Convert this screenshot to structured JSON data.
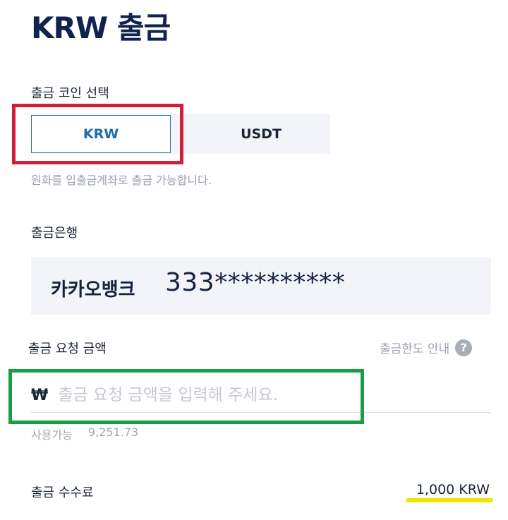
{
  "page": {
    "title": "KRW 출금"
  },
  "coin_select": {
    "label": "출금 코인 선택",
    "options": [
      "KRW",
      "USDT"
    ],
    "selected": "KRW",
    "hint": "원화를 입출금계좌로 출금 가능합니다."
  },
  "bank": {
    "label": "출금은행",
    "name": "카카오뱅크",
    "account_masked": "333**********"
  },
  "amount": {
    "label": "출금 요청 금액",
    "limit_guide": "출금한도 안내",
    "help_glyph": "?",
    "currency_symbol": "₩",
    "placeholder": "출금 요청 금액을 입력해 주세요.",
    "value": "",
    "available_label": "사용가능",
    "available_value": "9,251.73"
  },
  "fee": {
    "label": "출금 수수료",
    "value": "1,000 KRW"
  },
  "annotations": {
    "red_box": "#d01f3a",
    "green_box": "#17a03f",
    "yellow_underline": "#f2e600"
  },
  "colors": {
    "title": "#0f2250",
    "accent": "#1f6aa8",
    "panel_bg": "#f3f4f9"
  }
}
